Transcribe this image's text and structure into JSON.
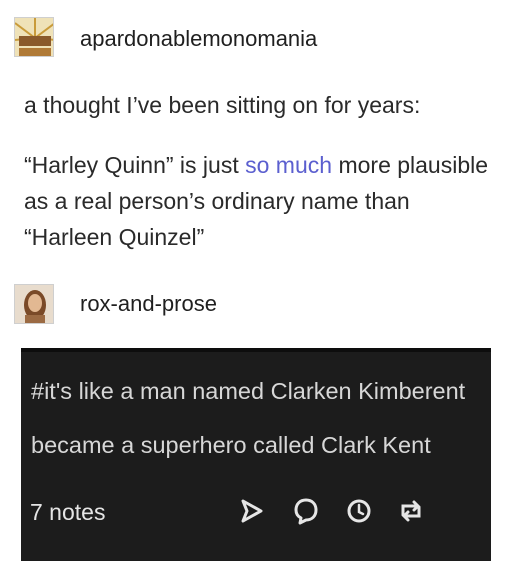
{
  "posts": [
    {
      "username": "apardonablemonomania",
      "paragraphs": [
        [
          "a thought I’ve been sitting on for years:"
        ],
        [
          "“Harley Quinn” is just ",
          "so much",
          " more plausible as a real person’s ordinary name than “Harleen Quinzel”"
        ]
      ]
    },
    {
      "username": "rox-and-prose"
    }
  ],
  "tags": {
    "text_line1": "#it's like a man named Clarken Kimberent",
    "text_line2": "became a superhero called Clark Kent",
    "notes": "7 notes",
    "actions": [
      "share-icon",
      "reply-icon",
      "history-icon",
      "reblog-icon"
    ]
  },
  "colors": {
    "link_highlight": "#5b5fcf",
    "dark_panel": "#1c1c1c"
  }
}
